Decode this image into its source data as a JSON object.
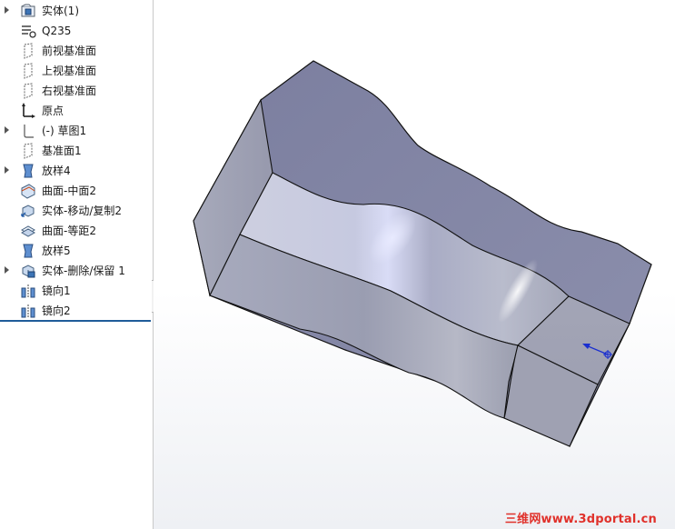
{
  "feature_tree": {
    "items": [
      {
        "label": "实体(1)",
        "icon": "solid-bodies-folder-icon",
        "expandable": true
      },
      {
        "label": "Q235",
        "icon": "material-icon",
        "expandable": false
      },
      {
        "label": "前视基准面",
        "icon": "plane-icon",
        "expandable": false
      },
      {
        "label": "上视基准面",
        "icon": "plane-icon",
        "expandable": false
      },
      {
        "label": "右视基准面",
        "icon": "plane-icon",
        "expandable": false
      },
      {
        "label": "原点",
        "icon": "origin-icon",
        "expandable": false
      },
      {
        "label": "(-) 草图1",
        "icon": "sketch-icon",
        "expandable": true
      },
      {
        "label": "基准面1",
        "icon": "plane-icon",
        "expandable": false
      },
      {
        "label": "放样4",
        "icon": "loft-icon",
        "expandable": true
      },
      {
        "label": "曲面-中面2",
        "icon": "mid-surface-icon",
        "expandable": false
      },
      {
        "label": "实体-移动/复制2",
        "icon": "move-copy-body-icon",
        "expandable": false
      },
      {
        "label": "曲面-等距2",
        "icon": "offset-surface-icon",
        "expandable": false
      },
      {
        "label": "放样5",
        "icon": "loft-icon",
        "expandable": false
      },
      {
        "label": "实体-删除/保留 1",
        "icon": "delete-keep-body-icon",
        "expandable": true
      },
      {
        "label": "镜向1",
        "icon": "mirror-icon",
        "expandable": false
      },
      {
        "label": "镜向2",
        "icon": "mirror-icon",
        "expandable": false
      }
    ]
  },
  "viewport": {
    "watermark": "三维网www.3dportal.cn",
    "colors": {
      "face_top": "#8688a8",
      "face_side": "#9ea1b4",
      "accent_blue": "#1f5c99",
      "triad_blue": "#1a2fd0",
      "watermark_red": "#e0312b"
    }
  }
}
